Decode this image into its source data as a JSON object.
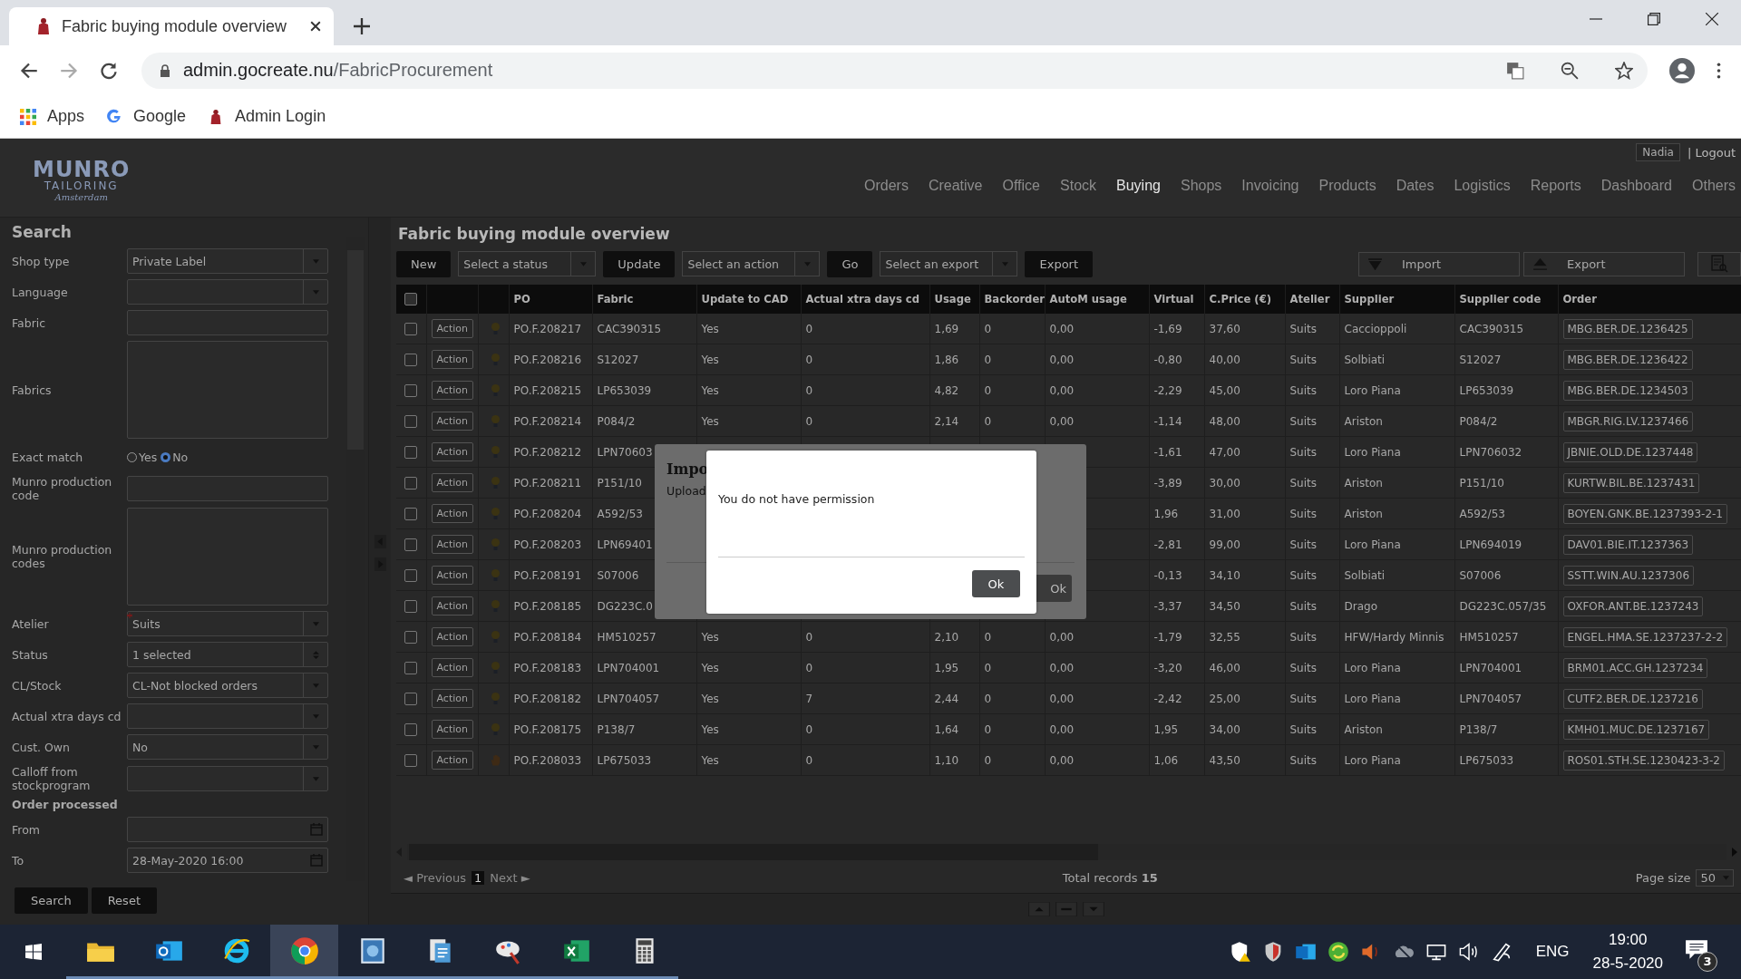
{
  "browser": {
    "tab_title": "Fabric buying module overview",
    "url_host": "admin.gocreate.nu",
    "url_path": "/FabricProcurement",
    "bookmarks": [
      {
        "label": "Apps",
        "kind": "apps"
      },
      {
        "label": "Google",
        "kind": "google"
      },
      {
        "label": "Admin Login",
        "kind": "site"
      }
    ]
  },
  "header": {
    "logo": {
      "name": "MUNRO",
      "sub": "TAILORING",
      "city": "Amsterdam"
    },
    "user": "Nadia",
    "logout": "| Logout",
    "nav": [
      {
        "label": "Orders",
        "selected": false
      },
      {
        "label": "Creative",
        "selected": false
      },
      {
        "label": "Office",
        "selected": false
      },
      {
        "label": "Stock",
        "selected": false
      },
      {
        "label": "Buying",
        "selected": true
      },
      {
        "label": "Shops",
        "selected": false
      },
      {
        "label": "Invoicing",
        "selected": false
      },
      {
        "label": "Products",
        "selected": false
      },
      {
        "label": "Dates",
        "selected": false
      },
      {
        "label": "Logistics",
        "selected": false
      },
      {
        "label": "Reports",
        "selected": false
      },
      {
        "label": "Dashboard",
        "selected": false
      },
      {
        "label": "Others",
        "selected": false
      }
    ]
  },
  "search": {
    "title": "Search",
    "fields": [
      {
        "label": "Shop type",
        "kind": "select",
        "value": "Private Label"
      },
      {
        "label": "Language",
        "kind": "select"
      },
      {
        "label": "Fabric",
        "kind": "text"
      },
      {
        "label": "Fabrics",
        "kind": "textarea"
      },
      {
        "label": "Exact match",
        "kind": "radio",
        "options": [
          {
            "label": "Yes",
            "selected": false
          },
          {
            "label": "No",
            "selected": true
          }
        ]
      },
      {
        "label": "Munro production code",
        "kind": "text"
      },
      {
        "label": "Munro production codes",
        "kind": "textarea"
      },
      {
        "label": "Atelier",
        "kind": "select",
        "value": "Suits",
        "required": true
      },
      {
        "label": "Status",
        "kind": "multiselect",
        "value": "1 selected"
      },
      {
        "label": "CL/Stock",
        "kind": "select",
        "value": "CL-Not blocked orders"
      },
      {
        "label": "Actual xtra days cd",
        "kind": "select"
      },
      {
        "label": "Cust. Own",
        "kind": "select",
        "value": "No"
      },
      {
        "label": "Calloff from stockprogram",
        "kind": "select"
      },
      {
        "label": "Order processed",
        "kind": "heading"
      },
      {
        "label": "From",
        "kind": "date"
      },
      {
        "label": "To",
        "kind": "date",
        "value": "28-May-2020 16:00"
      }
    ],
    "buttons": [
      "Search",
      "Reset"
    ]
  },
  "main": {
    "title": "Fabric buying module overview",
    "toolbar": [
      {
        "kind": "button",
        "label": "New"
      },
      {
        "kind": "select",
        "label": "Select a status"
      },
      {
        "kind": "button",
        "label": "Update"
      },
      {
        "kind": "select",
        "label": "Select an action"
      },
      {
        "kind": "button",
        "label": "Go"
      },
      {
        "kind": "select",
        "label": "Select an export"
      },
      {
        "kind": "button",
        "label": "Export"
      }
    ],
    "tools": [
      {
        "kind": "import",
        "label": "Import"
      },
      {
        "kind": "export",
        "label": "Export"
      }
    ],
    "table": {
      "columns": [
        "PO",
        "Fabric",
        "Update to CAD",
        "Actual xtra days cd",
        "Usage",
        "Backorder",
        "AutoM usage",
        "Virtual",
        "C.Price (€)",
        "Atelier",
        "Supplier",
        "Supplier code",
        "Order"
      ],
      "select_all_checked": false,
      "rows": [
        {
          "kind": "bulb",
          "checked": false,
          "action": "Action",
          "cells": [
            "PO.F.208217",
            "CAC390315",
            "Yes",
            "0",
            "1,69",
            "0",
            "0,00",
            "-1,69",
            "37,60",
            "Suits",
            "Caccioppoli",
            "CAC390315",
            "MBG.BER.DE.1236425"
          ]
        },
        {
          "kind": "bulb",
          "checked": false,
          "action": "Action",
          "cells": [
            "PO.F.208216",
            "S12027",
            "Yes",
            "0",
            "1,86",
            "0",
            "0,00",
            "-0,80",
            "40,00",
            "Suits",
            "Solbiati",
            "S12027",
            "MBG.BER.DE.1236422"
          ]
        },
        {
          "kind": "bulb",
          "checked": false,
          "action": "Action",
          "cells": [
            "PO.F.208215",
            "LP653039",
            "Yes",
            "0",
            "4,82",
            "0",
            "0,00",
            "-2,29",
            "45,00",
            "Suits",
            "Loro Piana",
            "LP653039",
            "MBG.BER.DE.1234503"
          ]
        },
        {
          "kind": "bulb",
          "checked": false,
          "action": "Action",
          "cells": [
            "PO.F.208214",
            "P084/2",
            "Yes",
            "0",
            "2,14",
            "0",
            "0,00",
            "-1,14",
            "48,00",
            "Suits",
            "Ariston",
            "P084/2",
            "MBGR.RIG.LV.1237466"
          ]
        },
        {
          "kind": "bulb",
          "checked": false,
          "action": "Action",
          "cells": [
            "PO.F.208212",
            "LPN70603",
            null,
            null,
            null,
            null,
            null,
            "-1,61",
            "47,00",
            "Suits",
            "Loro Piana",
            "LPN706032",
            "JBNIE.OLD.DE.1237448"
          ]
        },
        {
          "kind": "bulb",
          "checked": false,
          "action": "Action",
          "cells": [
            "PO.F.208211",
            "P151/10",
            null,
            null,
            null,
            null,
            null,
            "-3,89",
            "30,00",
            "Suits",
            "Ariston",
            "P151/10",
            "KURTW.BIL.BE.1237431"
          ]
        },
        {
          "kind": "bulb",
          "checked": false,
          "action": "Action",
          "cells": [
            "PO.F.208204",
            "A592/53",
            null,
            null,
            null,
            null,
            null,
            "1,96",
            "31,00",
            "Suits",
            "Ariston",
            "A592/53",
            "BOYEN.GNK.BE.1237393-2-1"
          ]
        },
        {
          "kind": "bulb",
          "checked": false,
          "action": "Action",
          "cells": [
            "PO.F.208203",
            "LPN69401",
            null,
            null,
            null,
            null,
            null,
            "-2,81",
            "99,00",
            "Suits",
            "Loro Piana",
            "LPN694019",
            "DAV01.BIE.IT.1237363"
          ]
        },
        {
          "kind": "bulb",
          "checked": false,
          "action": "Action",
          "cells": [
            "PO.F.208191",
            "S07006",
            null,
            null,
            null,
            null,
            null,
            "-0,13",
            "34,10",
            "Suits",
            "Solbiati",
            "S07006",
            "SSTT.WIN.AU.1237306"
          ]
        },
        {
          "kind": "bulb",
          "checked": false,
          "action": "Action",
          "cells": [
            "PO.F.208185",
            "DG223C.0",
            null,
            null,
            null,
            null,
            null,
            "-3,37",
            "34,50",
            "Suits",
            "Drago",
            "DG223C.057/35",
            "OXFOR.ANT.BE.1237243"
          ]
        },
        {
          "kind": "bulb",
          "checked": false,
          "action": "Action",
          "cells": [
            "PO.F.208184",
            "HM510257",
            "Yes",
            "0",
            "2,10",
            "0",
            "0,00",
            "-1,79",
            "32,55",
            "Suits",
            "HFW/Hardy Minnis",
            "HM510257",
            "ENGEL.HMA.SE.1237237-2-2"
          ]
        },
        {
          "kind": "bulb",
          "checked": false,
          "action": "Action",
          "cells": [
            "PO.F.208183",
            "LPN704001",
            "Yes",
            "0",
            "1,95",
            "0",
            "0,00",
            "-3,20",
            "46,00",
            "Suits",
            "Loro Piana",
            "LPN704001",
            "BRM01.ACC.GH.1237234"
          ]
        },
        {
          "kind": "bulb",
          "checked": false,
          "action": "Action",
          "cells": [
            "PO.F.208182",
            "LPN704057",
            "Yes",
            "7",
            "2,44",
            "0",
            "0,00",
            "-2,42",
            "25,00",
            "Suits",
            "Loro Piana",
            "LPN704057",
            "CUTF2.BER.DE.1237216"
          ]
        },
        {
          "kind": "bulb",
          "checked": false,
          "action": "Action",
          "cells": [
            "PO.F.208175",
            "P138/7",
            "Yes",
            "0",
            "1,64",
            "0",
            "0,00",
            "1,95",
            "34,00",
            "Suits",
            "Ariston",
            "P138/7",
            "KMH01.MUC.DE.1237167"
          ]
        },
        {
          "kind": "hand",
          "checked": false,
          "action": "Action",
          "cells": [
            "PO.F.208033",
            "LP675033",
            "Yes",
            "0",
            "1,10",
            "0",
            "0,00",
            "1,06",
            "43,50",
            "Suits",
            "Loro Piana",
            "LP675033",
            "ROS01.STH.SE.1230423-3-2"
          ]
        }
      ]
    },
    "pager": {
      "previous": "◄ Previous",
      "pages": [
        {
          "label": "1",
          "selected": true
        }
      ],
      "next": "Next ►",
      "total": "Total records **15**",
      "page_size_label": "Page size",
      "page_size": "50"
    }
  },
  "import_dialog": {
    "title": "Impo",
    "text": "Upload",
    "button": "Ok"
  },
  "alert": {
    "message": "You do not have permission",
    "button": "Ok"
  },
  "taskbar": {
    "apps": [
      {
        "kind": "explorer",
        "selected": false
      },
      {
        "kind": "outlook",
        "selected": false
      },
      {
        "kind": "ie",
        "selected": false
      },
      {
        "kind": "chrome",
        "selected": true
      },
      {
        "kind": "app",
        "selected": false
      },
      {
        "kind": "files",
        "selected": false
      },
      {
        "kind": "paint",
        "selected": false
      },
      {
        "kind": "excel",
        "selected": false
      },
      {
        "kind": "calculator",
        "selected": false
      }
    ],
    "language": "ENG",
    "time": "19:00",
    "date": "28-5-2020",
    "notifications": "3"
  }
}
